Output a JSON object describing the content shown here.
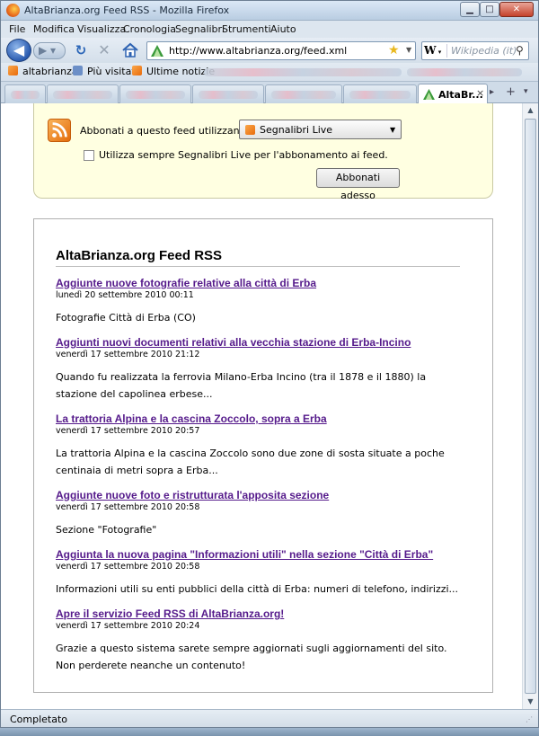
{
  "window": {
    "title": "AltaBrianza.org Feed RSS - Mozilla Firefox",
    "minimize_icon": "minimize-icon",
    "maximize_icon": "maximize-icon",
    "close_icon": "close-icon"
  },
  "menu": [
    "File",
    "Modifica",
    "Visualizza",
    "Cronologia",
    "Segnalibri",
    "Strumenti",
    "Aiuto"
  ],
  "nav": {
    "url": "http://www.altabrianza.org/feed.xml",
    "search_placeholder": "Wikipedia (it)",
    "search_engine_glyph": "W"
  },
  "bookmarks": [
    "altabrianza",
    "Più visitati",
    "Ultime notizie"
  ],
  "tabs": {
    "active_label": "AltaBr...",
    "close_glyph": "×"
  },
  "subscribe": {
    "label": "Abbonati a questo feed utilizzando",
    "selected": "Segnalibri Live",
    "checkbox_label": "Utilizza sempre Segnalibri Live per l'abbonamento ai feed.",
    "button": "Abbonati adesso"
  },
  "feed": {
    "title": "AltaBrianza.org Feed RSS",
    "entries": [
      {
        "title": "Aggiunte nuove fotografie relative alla città di Erba",
        "date": "lunedì 20 settembre 2010 00:11",
        "text": "Fotografie Città di Erba (CO)"
      },
      {
        "title": "Aggiunti nuovi documenti relativi alla vecchia stazione di Erba-Incino",
        "date": "venerdì 17 settembre 2010 21:12",
        "text": "Quando fu realizzata la ferrovia Milano-Erba Incino (tra il 1878 e il 1880) la stazione del capolinea erbese..."
      },
      {
        "title": "La trattoria Alpina e la cascina Zoccolo, sopra a Erba",
        "date": "venerdì 17 settembre 2010 20:57",
        "text": "La trattoria Alpina e la cascina Zoccolo sono due zone di sosta situate a poche centinaia di metri sopra a Erba..."
      },
      {
        "title": "Aggiunte nuove foto e ristrutturata l'apposita sezione",
        "date": "venerdì 17 settembre 2010 20:58",
        "text": "Sezione \"Fotografie\""
      },
      {
        "title": "Aggiunta la nuova pagina \"Informazioni utili\" nella sezione \"Città di Erba\"",
        "date": "venerdì 17 settembre 2010 20:58",
        "text": "Informazioni utili su enti pubblici della città di Erba: numeri di telefono, indirizzi..."
      },
      {
        "title": "Apre il servizio Feed RSS di AltaBrianza.org!",
        "date": "venerdì 17 settembre 2010 20:24",
        "text": "Grazie a questo sistema sarete sempre aggiornati sugli aggiornamenti del sito. Non perderete neanche un contenuto!"
      }
    ]
  },
  "status": "Completato",
  "colors": {
    "link": "#551a8b",
    "subscribe_bg": "#ffffe1",
    "rss_orange": "#e96c0c"
  }
}
